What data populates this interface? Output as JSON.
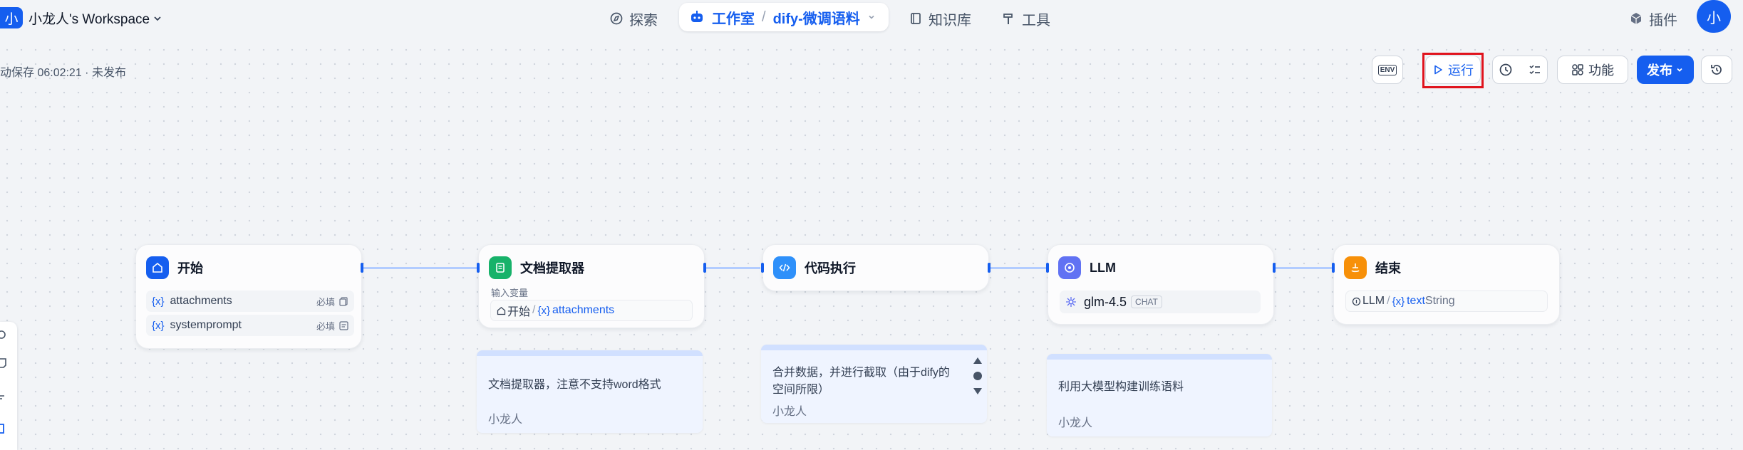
{
  "header": {
    "workspace_badge": "小",
    "workspace_name": "小龙人's Workspace",
    "nav": {
      "explore": "探索",
      "studio": "工作室",
      "app_name": "dify-微调语料",
      "knowledge": "知识库",
      "tools": "工具",
      "plugins": "插件"
    },
    "avatar": "小"
  },
  "toolbar": {
    "save_status": "动保存 06:02:21 · 未发布",
    "env_label": "ENV",
    "run_label": "运行",
    "features_label": "功能",
    "publish_label": "发布"
  },
  "nodes": {
    "start": {
      "title": "开始",
      "vars": [
        {
          "icon": "{x}",
          "name": "attachments",
          "required": "必填"
        },
        {
          "icon": "{x}",
          "name": "systemprompt",
          "required": "必填"
        }
      ]
    },
    "doc_extractor": {
      "title": "文档提取器",
      "input_label": "输入变量",
      "input_source": "开始",
      "input_sep": "/",
      "input_var_icon": "{x}",
      "input_var": "attachments"
    },
    "code": {
      "title": "代码执行"
    },
    "llm": {
      "title": "LLM",
      "model": "glm-4.5",
      "model_mode": "CHAT"
    },
    "end": {
      "title": "结束",
      "output_source": "LLM",
      "output_sep": "/",
      "output_var_icon": "{x}",
      "output_var": "text",
      "output_type": "String"
    }
  },
  "notes": [
    {
      "text": "文档提取器，注意不支持word格式",
      "author": "小龙人"
    },
    {
      "text": "合并数据，并进行截取（由于dify的空间所限）",
      "author": "小龙人"
    },
    {
      "text": "利用大模型构建训练语料",
      "author": "小龙人"
    }
  ],
  "colors": {
    "accent": "#155eef",
    "start_icon": "#155eef",
    "doc_icon": "#17b26a",
    "code_icon": "#2e90fa",
    "llm_icon": "#6172f3",
    "end_icon": "#f79009",
    "highlight": "#e0131d"
  }
}
